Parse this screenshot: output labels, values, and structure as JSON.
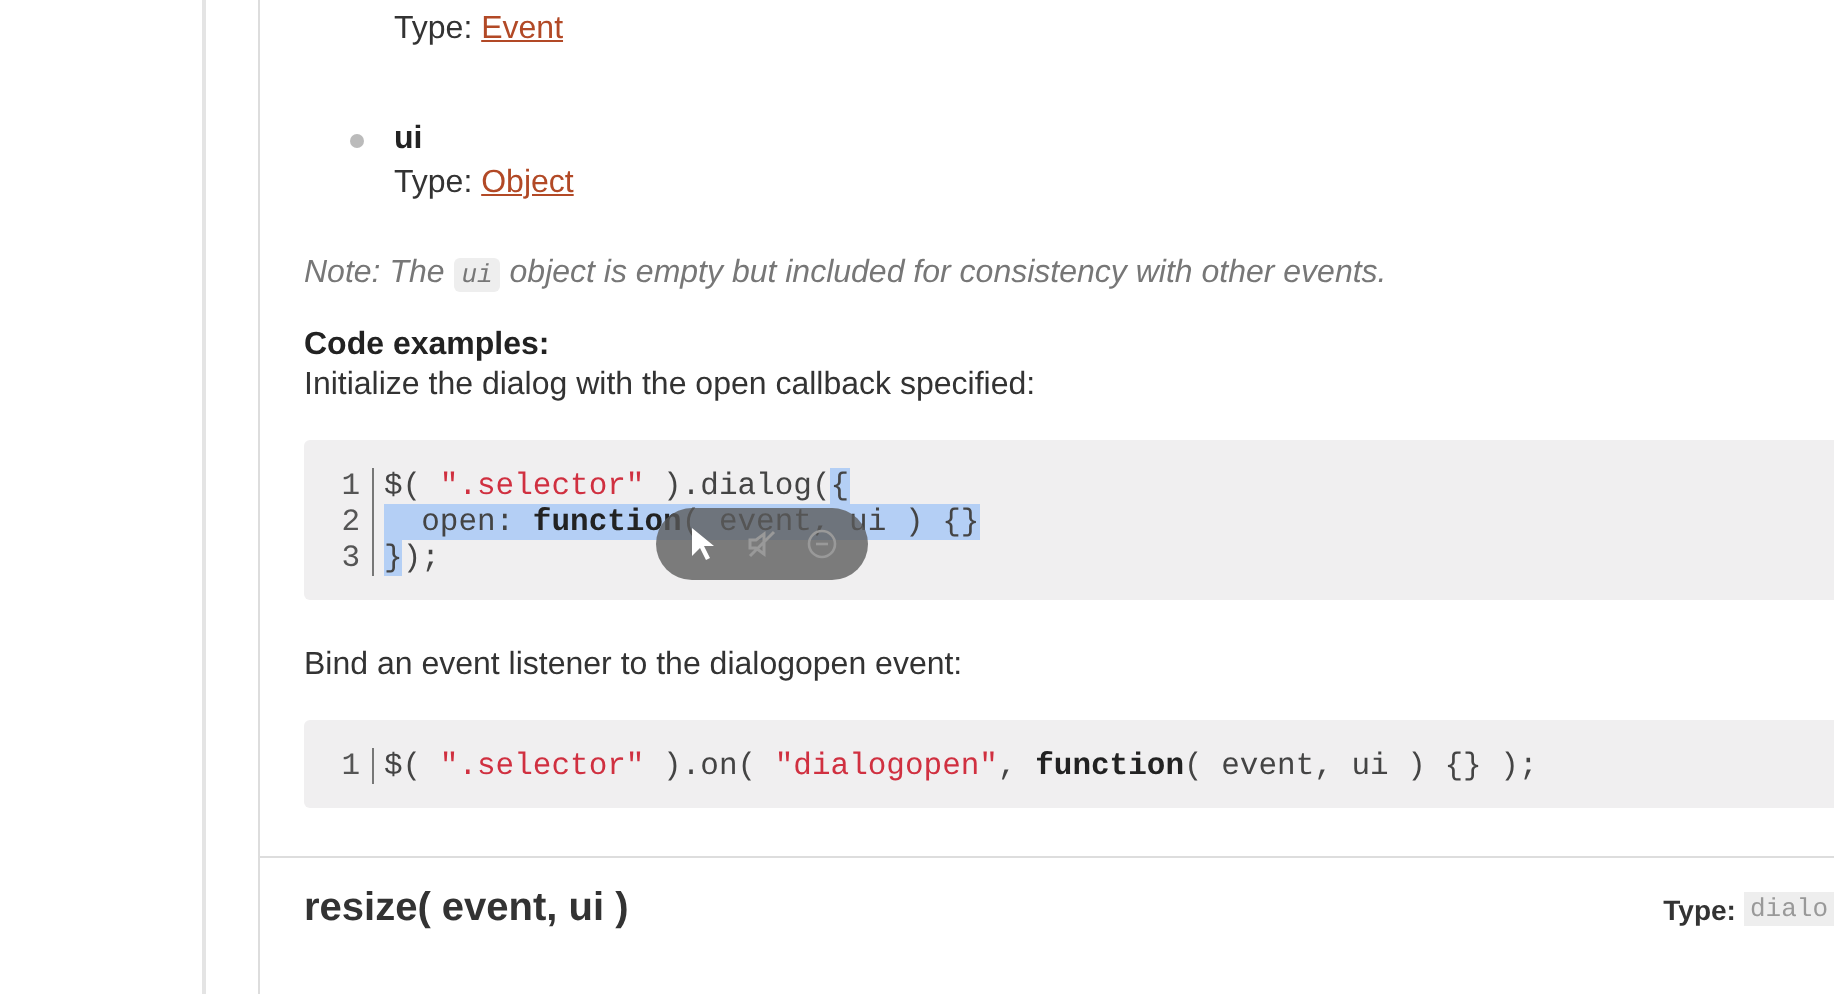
{
  "params": [
    {
      "type_label": "Type:",
      "type_link": "Event"
    },
    {
      "name": "ui",
      "type_label": "Type:",
      "type_link": "Object"
    }
  ],
  "note": {
    "before": "Note: The",
    "code": "ui",
    "after": "object is empty but included for consistency with other events."
  },
  "examples_heading": "Code examples:",
  "examples": [
    {
      "caption": "Initialize the dialog with the open callback specified:",
      "lines": [
        {
          "number": "1",
          "tokens": [
            {
              "kind": "plain",
              "text": "$( ",
              "selected": false
            },
            {
              "kind": "string",
              "text": "\".selector\"",
              "selected": false
            },
            {
              "kind": "plain",
              "text": " ).dialog(",
              "selected": false
            },
            {
              "kind": "plain",
              "text": "{",
              "selected": true
            }
          ]
        },
        {
          "number": "2",
          "tokens": [
            {
              "kind": "plain",
              "text": "  open: ",
              "selected": true
            },
            {
              "kind": "keyword",
              "text": "function",
              "selected": true
            },
            {
              "kind": "plain",
              "text": "( event, ui ) {}",
              "selected": true
            }
          ]
        },
        {
          "number": "3",
          "tokens": [
            {
              "kind": "plain",
              "text": "}",
              "selected": true
            },
            {
              "kind": "plain",
              "text": ");",
              "selected": false
            }
          ]
        }
      ]
    },
    {
      "caption": "Bind an event listener to the dialogopen event:",
      "lines": [
        {
          "number": "1",
          "tokens": [
            {
              "kind": "plain",
              "text": "$( ",
              "selected": false
            },
            {
              "kind": "string",
              "text": "\".selector\"",
              "selected": false
            },
            {
              "kind": "plain",
              "text": " ).on( ",
              "selected": false
            },
            {
              "kind": "string",
              "text": "\"dialogopen\"",
              "selected": false
            },
            {
              "kind": "plain",
              "text": ", ",
              "selected": false
            },
            {
              "kind": "keyword",
              "text": "function",
              "selected": false
            },
            {
              "kind": "plain",
              "text": "( event, ui ) {} );",
              "selected": false
            }
          ]
        }
      ]
    }
  ],
  "next_event": {
    "signature": "resize( event, ui )",
    "type_label": "Type:",
    "type_value": "dialo"
  }
}
